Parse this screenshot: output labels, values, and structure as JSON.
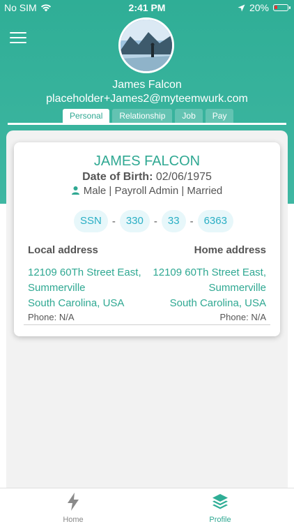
{
  "status_bar": {
    "carrier": "No SIM",
    "time": "2:41 PM",
    "battery": "20%"
  },
  "profile": {
    "name": "James Falcon",
    "email": "placeholder+James2@myteemwurk.com"
  },
  "tabs": [
    {
      "label": "Personal",
      "active": true
    },
    {
      "label": "Relationship",
      "active": false
    },
    {
      "label": "Job",
      "active": false
    },
    {
      "label": "Pay",
      "active": false
    }
  ],
  "card": {
    "full_name": "JAMES FALCON",
    "dob_label": "Date of Birth:",
    "dob_value": "02/06/1975",
    "details": "Male | Payroll Admin | Married",
    "ssn_label": "SSN",
    "ssn_parts": [
      "330",
      "33",
      "6363"
    ],
    "ssn_sep": "-",
    "local_address": {
      "title": "Local address",
      "line1": "12109 60Th Street East,",
      "line2": "Summerville",
      "line3": "South Carolina, USA",
      "phone": "Phone: N/A"
    },
    "home_address": {
      "title": "Home address",
      "line1": "12109 60Th Street East,",
      "line2": "Summerville",
      "line3": "South Carolina, USA",
      "phone": "Phone: N/A"
    }
  },
  "tabbar": {
    "home_label": "Home",
    "profile_label": "Profile",
    "active": "Profile"
  },
  "colors": {
    "brand": "#2fae96",
    "accent_text": "#2fa892",
    "ssn_text": "#29aec4",
    "battery_low": "#e33232"
  },
  "icons": [
    "wifi-icon",
    "location-arrow-icon",
    "battery-icon",
    "menu-icon",
    "person-icon",
    "lightning-icon",
    "layers-icon"
  ]
}
